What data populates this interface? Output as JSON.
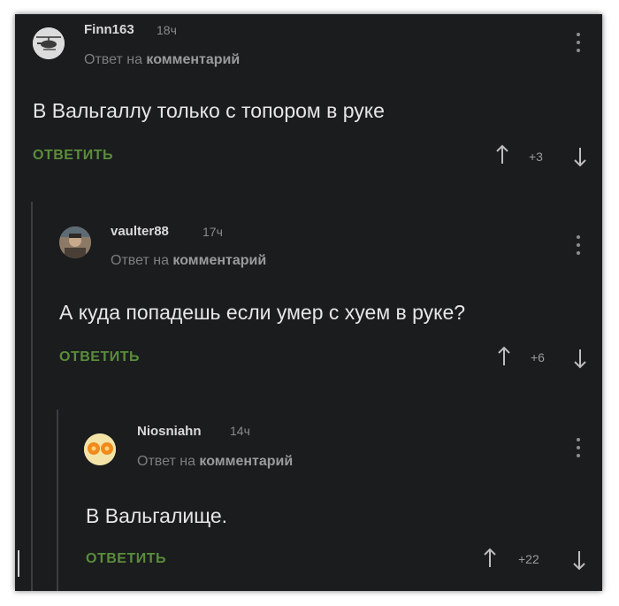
{
  "comments": [
    {
      "username": "Finn163",
      "time": "18ч",
      "reply_prefix": "Ответ на",
      "reply_target": "комментарий",
      "text": "В Вальгаллу только с топором в руке",
      "reply_label": "ОТВЕТИТЬ",
      "score": "+3",
      "avatar_icon": "helicopter-icon"
    },
    {
      "username": "vaulter88",
      "time": "17ч",
      "reply_prefix": "Ответ на",
      "reply_target": "комментарий",
      "text": "А куда попадешь если умер с хуем в руке?",
      "reply_label": "ОТВЕТИТЬ",
      "score": "+6",
      "avatar_icon": "person-photo-icon"
    },
    {
      "username": "Niosniahn",
      "time": "14ч",
      "reply_prefix": "Ответ на",
      "reply_target": "комментарий",
      "text": "В Вальгалище.",
      "reply_label": "ОТВЕТИТЬ",
      "score": "+22",
      "avatar_icon": "orange-face-icon"
    }
  ],
  "colors": {
    "background": "#1b1c1e",
    "reply_green": "#5a8d3a",
    "text": "#e6e6e6",
    "muted": "#8a8b8d"
  }
}
